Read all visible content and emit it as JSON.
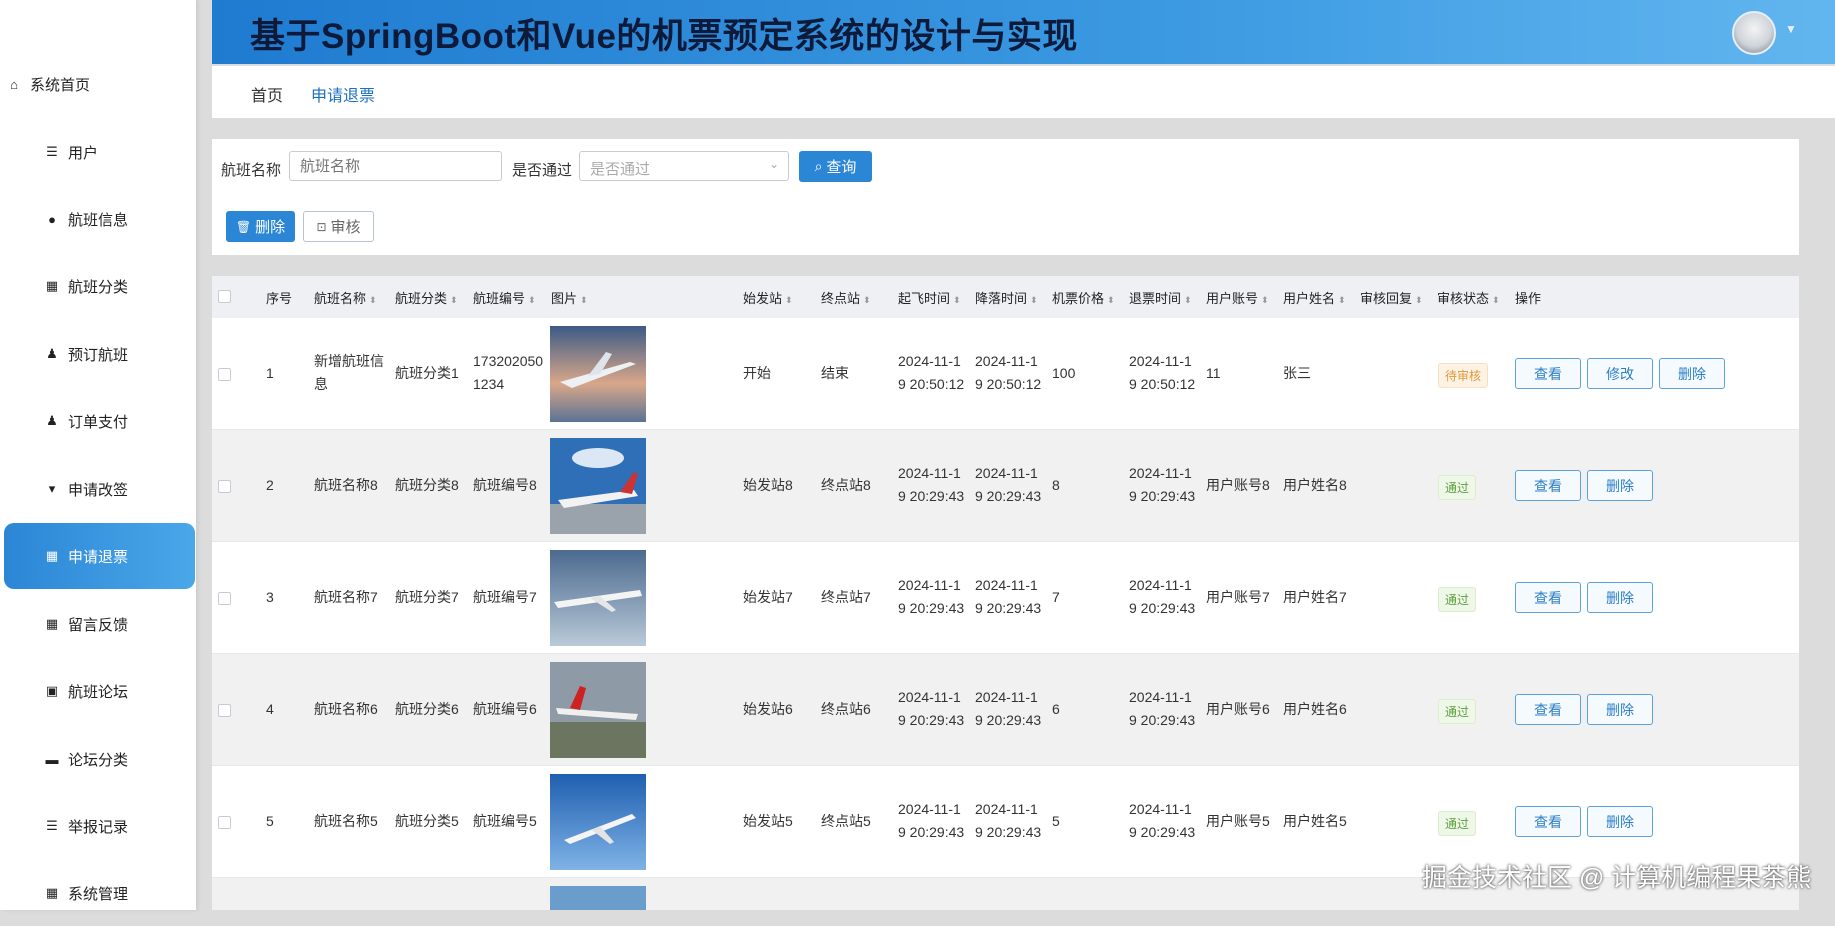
{
  "app": {
    "title": "基于SpringBoot和Vue的机票预定系统的设计与实现"
  },
  "colors": {
    "accent": "#2b86d6",
    "header_gradient_start": "#1f7bd0",
    "header_gradient_end": "#62b6ef",
    "pending": "#e09b3d",
    "pass": "#5aa33a"
  },
  "sidebar": {
    "items": [
      {
        "label": "系统首页",
        "icon": "home-icon"
      },
      {
        "label": "用户",
        "icon": "list-icon"
      },
      {
        "label": "航班信息",
        "icon": "pin-icon"
      },
      {
        "label": "航班分类",
        "icon": "grid-icon"
      },
      {
        "label": "预订航班",
        "icon": "user-icon"
      },
      {
        "label": "订单支付",
        "icon": "user-icon"
      },
      {
        "label": "申请改签",
        "icon": "pin-icon"
      },
      {
        "label": "申请退票",
        "icon": "grid-icon"
      },
      {
        "label": "留言反馈",
        "icon": "table-icon"
      },
      {
        "label": "航班论坛",
        "icon": "clipboard-icon"
      },
      {
        "label": "论坛分类",
        "icon": "monitor-icon"
      },
      {
        "label": "举报记录",
        "icon": "list-icon"
      },
      {
        "label": "系统管理",
        "icon": "grid-icon"
      }
    ]
  },
  "breadcrumb": {
    "home": "首页",
    "current": "申请退票"
  },
  "search": {
    "flight_name_label": "航班名称",
    "flight_name_placeholder": "航班名称",
    "pass_label": "是否通过",
    "pass_placeholder": "是否通过",
    "query_label": "查询",
    "delete_label": "删除",
    "review_label": "审核"
  },
  "table": {
    "columns": [
      "序号",
      "航班名称",
      "航班分类",
      "航班编号",
      "图片",
      "始发站",
      "终点站",
      "起飞时间",
      "降落时间",
      "机票价格",
      "退票时间",
      "用户账号",
      "用户姓名",
      "审核回复",
      "审核状态",
      "操作"
    ],
    "rows": [
      {
        "index": "1",
        "name": "新增航班信息",
        "category": "航班分类1",
        "number": "173202050 1234",
        "origin": "开始",
        "dest": "结束",
        "depart": "2024-11-1 9 20:50:12",
        "arrive": "2024-11-1 9 20:50:12",
        "price": "100",
        "refund_time": "2024-11-1 9 20:50:12",
        "account": "11",
        "user_name": "张三",
        "reply": "",
        "status": "待审核",
        "actions": [
          "查看",
          "修改",
          "删除"
        ]
      },
      {
        "index": "2",
        "name": "航班名称8",
        "category": "航班分类8",
        "number": "航班编号8",
        "origin": "始发站8",
        "dest": "终点站8",
        "depart": "2024-11-1 9 20:29:43",
        "arrive": "2024-11-1 9 20:29:43",
        "price": "8",
        "refund_time": "2024-11-1 9 20:29:43",
        "account": "用户账号8",
        "user_name": "用户姓名8",
        "reply": "",
        "status": "通过",
        "actions": [
          "查看",
          "删除"
        ]
      },
      {
        "index": "3",
        "name": "航班名称7",
        "category": "航班分类7",
        "number": "航班编号7",
        "origin": "始发站7",
        "dest": "终点站7",
        "depart": "2024-11-1 9 20:29:43",
        "arrive": "2024-11-1 9 20:29:43",
        "price": "7",
        "refund_time": "2024-11-1 9 20:29:43",
        "account": "用户账号7",
        "user_name": "用户姓名7",
        "reply": "",
        "status": "通过",
        "actions": [
          "查看",
          "删除"
        ]
      },
      {
        "index": "4",
        "name": "航班名称6",
        "category": "航班分类6",
        "number": "航班编号6",
        "origin": "始发站6",
        "dest": "终点站6",
        "depart": "2024-11-1 9 20:29:43",
        "arrive": "2024-11-1 9 20:29:43",
        "price": "6",
        "refund_time": "2024-11-1 9 20:29:43",
        "account": "用户账号6",
        "user_name": "用户姓名6",
        "reply": "",
        "status": "通过",
        "actions": [
          "查看",
          "删除"
        ]
      },
      {
        "index": "5",
        "name": "航班名称5",
        "category": "航班分类5",
        "number": "航班编号5",
        "origin": "始发站5",
        "dest": "终点站5",
        "depart": "2024-11-1 9 20:29:43",
        "arrive": "2024-11-1 9 20:29:43",
        "price": "5",
        "refund_time": "2024-11-1 9 20:29:43",
        "account": "用户账号5",
        "user_name": "用户姓名5",
        "reply": "",
        "status": "通过",
        "actions": [
          "查看",
          "删除"
        ]
      }
    ]
  },
  "watermark": {
    "text": "掘金技术社区 @ 计算机编程果茶熊"
  }
}
